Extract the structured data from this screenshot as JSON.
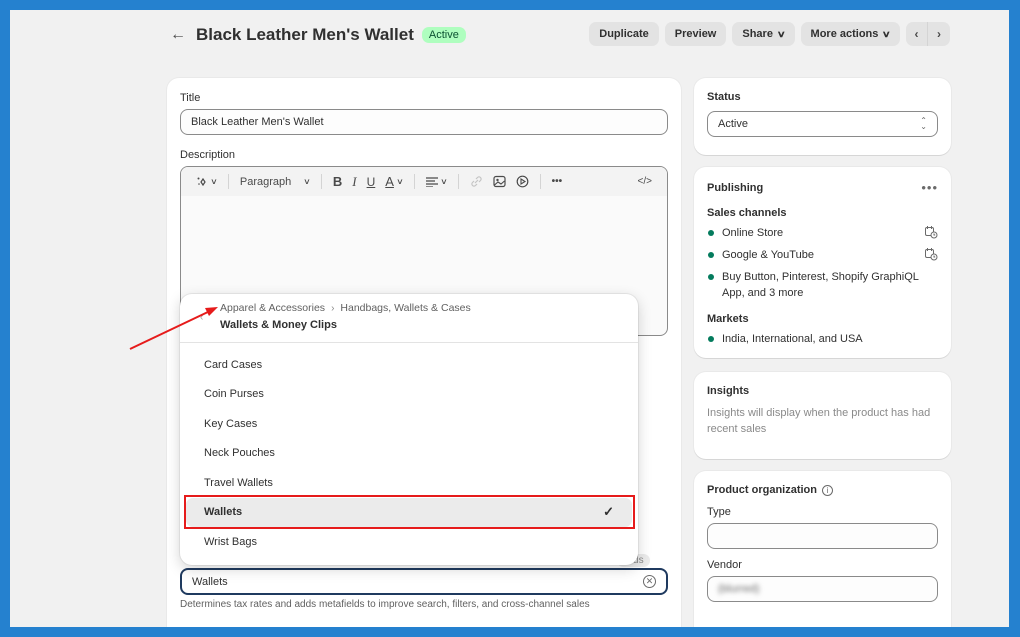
{
  "header": {
    "back_label": "←",
    "title": "Black Leather Men's Wallet",
    "status_badge": "Active",
    "actions": {
      "duplicate": "Duplicate",
      "preview": "Preview",
      "share": "Share",
      "more_actions": "More actions"
    },
    "pager": {
      "prev": "‹",
      "next": "›"
    }
  },
  "main": {
    "title_label": "Title",
    "title_value": "Black Leather Men's Wallet",
    "description_label": "Description",
    "editor_toolbar": {
      "paragraph_select": "Paragraph",
      "bold": "B",
      "italic": "I",
      "underline": "U",
      "text_color": "A",
      "more": "•••",
      "code": "</>"
    },
    "category": {
      "value": "Wallets",
      "help_text": "Determines tax rates and adds metafields to improve search, filters, and cross-channel sales",
      "hidden_badge": "ields"
    }
  },
  "category_dropdown": {
    "breadcrumb": [
      "Apparel & Accessories",
      "Handbags, Wallets & Cases"
    ],
    "current": "Wallets & Money Clips",
    "items": [
      {
        "label": "Card Cases",
        "selected": false
      },
      {
        "label": "Coin Purses",
        "selected": false
      },
      {
        "label": "Key Cases",
        "selected": false
      },
      {
        "label": "Neck Pouches",
        "selected": false
      },
      {
        "label": "Travel Wallets",
        "selected": false
      },
      {
        "label": "Wallets",
        "selected": true
      },
      {
        "label": "Wrist Bags",
        "selected": false
      }
    ],
    "check_glyph": "✓"
  },
  "sidebar": {
    "status": {
      "title": "Status",
      "value": "Active"
    },
    "publishing": {
      "title": "Publishing",
      "sales_channels_title": "Sales channels",
      "channels": [
        "Online Store",
        "Google & YouTube",
        "Buy Button, Pinterest, Shopify GraphiQL App, and 3 more"
      ],
      "markets_title": "Markets",
      "markets": "India, International, and USA"
    },
    "insights": {
      "title": "Insights",
      "text": "Insights will display when the product has had recent sales"
    },
    "organization": {
      "title": "Product organization",
      "type_label": "Type",
      "type_value": "",
      "vendor_label": "Vendor",
      "vendor_value": "(blurred)"
    }
  },
  "colors": {
    "frame": "#2581cf",
    "page_bg": "#f1f1f1",
    "active_badge_bg": "#affebf",
    "active_badge_text": "#0c5132",
    "channel_dot": "#047b5d",
    "annotation_red": "#e61b1b",
    "focus_border": "#1f3a5f"
  }
}
